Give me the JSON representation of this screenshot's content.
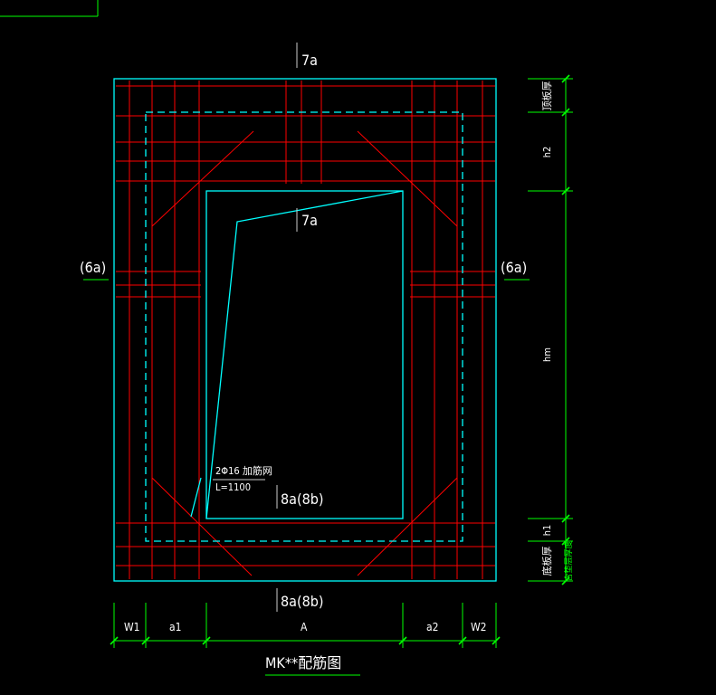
{
  "drawing": {
    "title": "MK**配筋图",
    "labels": {
      "top_rebar": "7a",
      "inner_rebar": "7a",
      "left_side": "(6a)",
      "right_side": "(6a)",
      "inner_bottom": "8a(8b)",
      "outer_bottom": "8a(8b)"
    },
    "note": {
      "line1": "2Φ16 加筋网",
      "line2": "L=1100"
    },
    "dimensions_bottom": [
      "W1",
      "a1",
      "A",
      "a2",
      "W2"
    ],
    "dimensions_right": {
      "top": "顶板厚",
      "upper": "h2",
      "middle": "hm",
      "lower": "h1",
      "bottom": "底板厚",
      "green_note": "含垫层厚度"
    }
  },
  "colors": {
    "background": "#000000",
    "rebar": "#ff0000",
    "outline": "#00ffff",
    "dimension": "#00ff00",
    "text": "#ffffff"
  }
}
